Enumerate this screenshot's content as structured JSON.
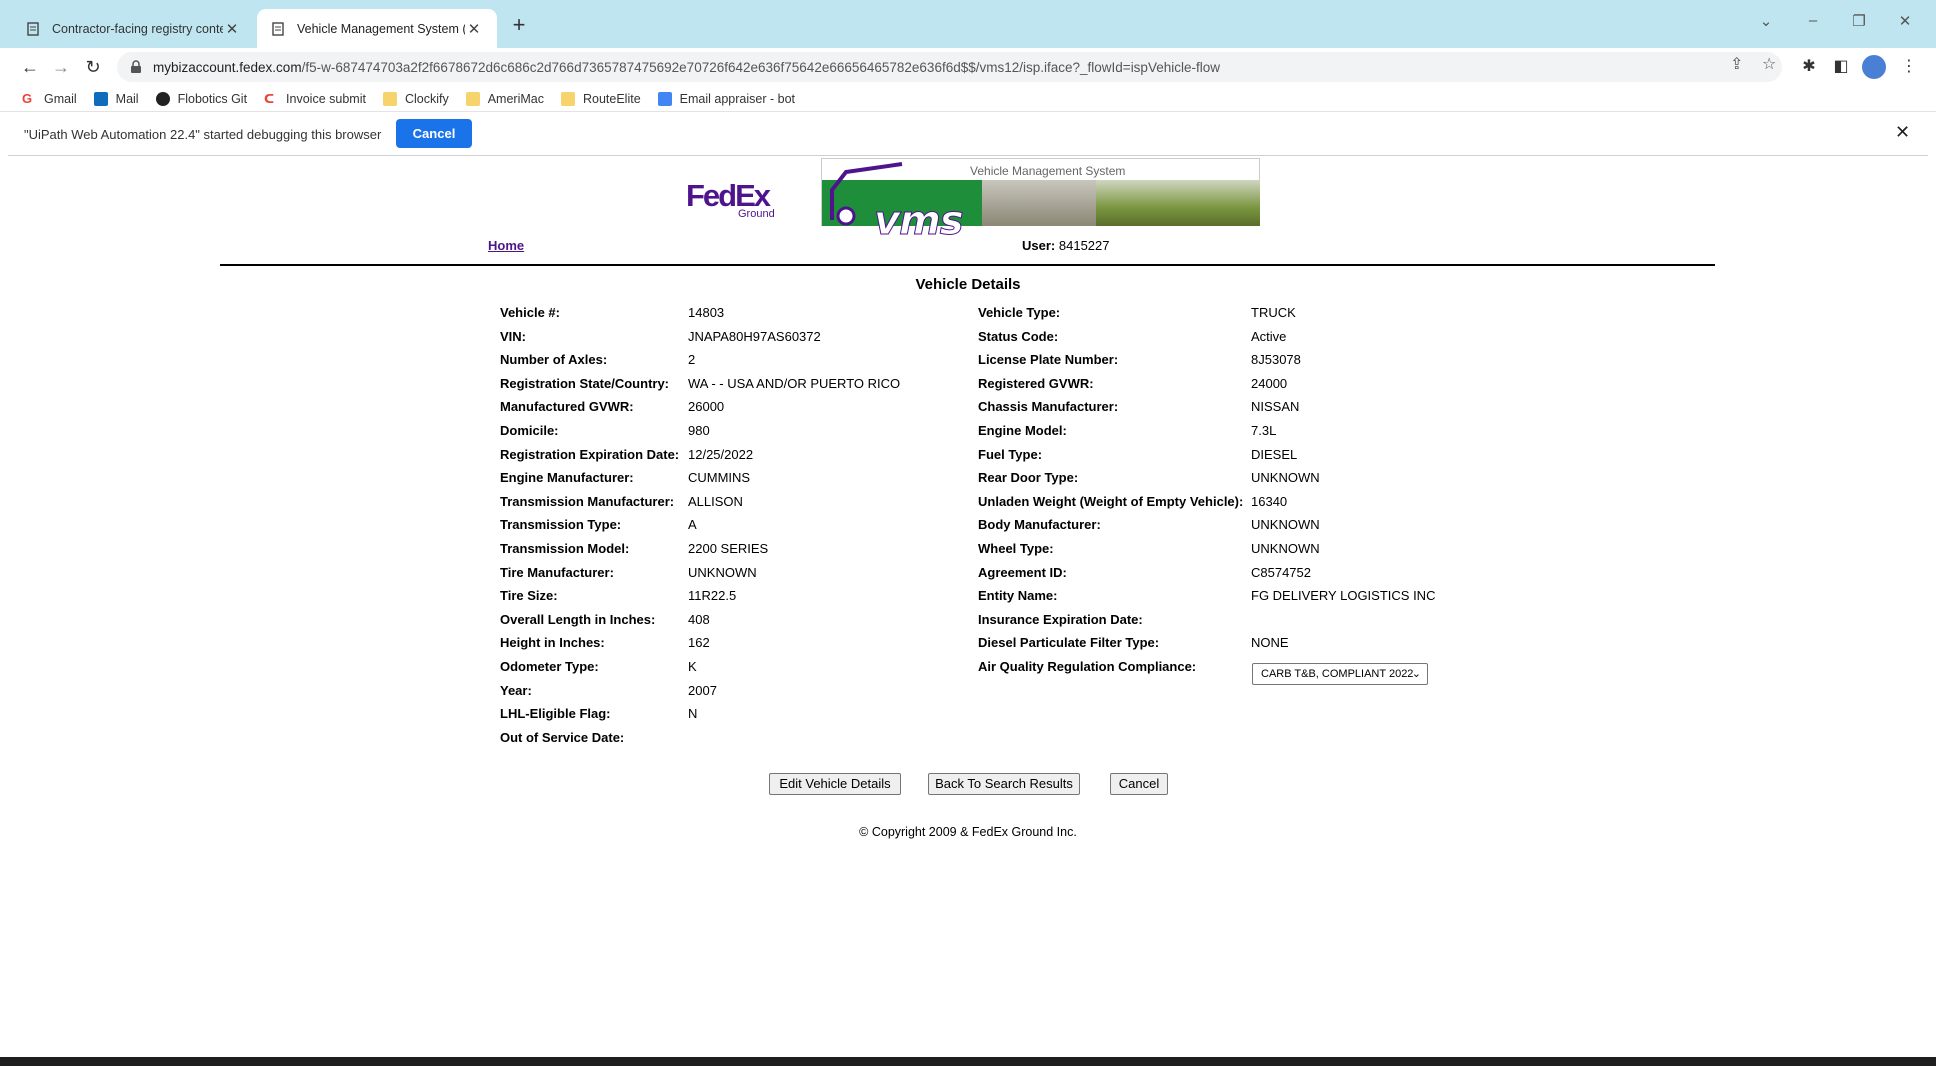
{
  "browser": {
    "tabs": [
      {
        "title": "Contractor-facing registry conten",
        "active": false
      },
      {
        "title": "Vehicle Management System (VM",
        "active": true
      }
    ],
    "url_host": "mybizaccount.fedex.com",
    "url_path": "/f5-w-687474703a2f2f6678672d6c686c2d766d7365787475692e70726f642e636f75642e66656465782e636f6d$$/vms12/isp.iface?_flowId=ispVehicle-flow",
    "bookmarks": [
      {
        "label": "Gmail",
        "icon": "gmail-icon"
      },
      {
        "label": "Mail",
        "icon": "outlook-icon"
      },
      {
        "label": "Flobotics Git",
        "icon": "github-icon"
      },
      {
        "label": "Invoice submit",
        "icon": "clickup-icon"
      },
      {
        "label": "Clockify",
        "icon": "folder-icon"
      },
      {
        "label": "AmeriMac",
        "icon": "folder-icon"
      },
      {
        "label": "RouteElite",
        "icon": "folder-icon"
      },
      {
        "label": "Email appraiser - bot",
        "icon": "docs-icon"
      }
    ],
    "infobar": {
      "message": "\"UiPath Web Automation 22.4\" started debugging this browser",
      "cancel_label": "Cancel"
    }
  },
  "page": {
    "logo": {
      "brand_fed": "Fed",
      "brand_ex": "Ex",
      "sub": "Ground"
    },
    "banner_caption": "Vehicle Management System",
    "banner_text": "vms",
    "home_label": "Home",
    "user_label": "User:",
    "user_value": "8415227",
    "title": "Vehicle Details",
    "left_fields": [
      {
        "label": "Vehicle #:",
        "value": "14803"
      },
      {
        "label": "VIN:",
        "value": "JNAPA80H97AS60372"
      },
      {
        "label": "Number of Axles:",
        "value": "2"
      },
      {
        "label": "Registration State/Country:",
        "value": "WA - - USA AND/OR PUERTO RICO"
      },
      {
        "label": "Manufactured GVWR:",
        "value": "26000"
      },
      {
        "label": "Domicile:",
        "value": "980"
      },
      {
        "label": "Registration Expiration Date:",
        "value": "12/25/2022"
      },
      {
        "label": "Engine Manufacturer:",
        "value": "CUMMINS"
      },
      {
        "label": "Transmission Manufacturer:",
        "value": "ALLISON"
      },
      {
        "label": "Transmission Type:",
        "value": "A"
      },
      {
        "label": "Transmission Model:",
        "value": "2200 SERIES"
      },
      {
        "label": "Tire Manufacturer:",
        "value": "UNKNOWN"
      },
      {
        "label": "Tire Size:",
        "value": "11R22.5"
      },
      {
        "label": "Overall Length in Inches:",
        "value": "408"
      },
      {
        "label": "Height in Inches:",
        "value": "162"
      },
      {
        "label": "Odometer Type:",
        "value": "K"
      },
      {
        "label": "Year:",
        "value": "2007"
      },
      {
        "label": "LHL-Eligible Flag:",
        "value": "N"
      },
      {
        "label": "Out of Service Date:",
        "value": ""
      }
    ],
    "right_fields": [
      {
        "label": "Vehicle Type:",
        "value": "TRUCK"
      },
      {
        "label": "Status Code:",
        "value": "Active"
      },
      {
        "label": "License Plate Number:",
        "value": "8J53078"
      },
      {
        "label": "Registered GVWR:",
        "value": "24000"
      },
      {
        "label": "Chassis Manufacturer:",
        "value": "NISSAN"
      },
      {
        "label": "Engine Model:",
        "value": "7.3L"
      },
      {
        "label": "Fuel Type:",
        "value": "DIESEL"
      },
      {
        "label": "Rear Door Type:",
        "value": "UNKNOWN"
      },
      {
        "label": "Unladen Weight (Weight of Empty Vehicle):",
        "value": "16340"
      },
      {
        "label": "Body Manufacturer:",
        "value": "UNKNOWN"
      },
      {
        "label": "Wheel Type:",
        "value": "UNKNOWN"
      },
      {
        "label": "Agreement ID:",
        "value": "C8574752"
      },
      {
        "label": "Entity Name:",
        "value": "FG DELIVERY LOGISTICS INC"
      },
      {
        "label": "Insurance Expiration Date:",
        "value": ""
      },
      {
        "label": "Diesel Particulate Filter Type:",
        "value": "NONE"
      },
      {
        "label": "Air Quality Regulation Compliance:",
        "value": ""
      }
    ],
    "air_quality_selected": "CARB T&B, COMPLIANT 2022",
    "buttons": {
      "edit": "Edit Vehicle Details",
      "back": "Back To Search Results",
      "cancel": "Cancel"
    },
    "copyright": "© Copyright 2009 & FedEx Ground Inc."
  }
}
